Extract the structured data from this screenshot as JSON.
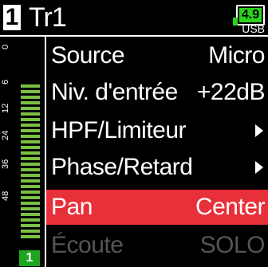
{
  "header": {
    "track_number": "1",
    "track_name": "Tr1",
    "battery": "4.9",
    "power_source": "USB",
    "battery_color": "#2bd31e"
  },
  "meter": {
    "scale": [
      "0",
      "6",
      "12",
      "24",
      "36",
      "48"
    ],
    "channel": "1",
    "bar_color": "#7bc043"
  },
  "menu": {
    "items": [
      {
        "label": "Source",
        "value": "Micro"
      },
      {
        "label": "Niv. d'entrée",
        "value": "+22dB"
      },
      {
        "label": "HPF/Limiteur",
        "icon": "chevron-right-icon"
      },
      {
        "label": "Phase/Retard",
        "icon": "chevron-right-icon"
      },
      {
        "label": "Pan",
        "value": "Center",
        "selected": true
      },
      {
        "label": "Écoute",
        "value": "SOLO",
        "disabled": true
      }
    ],
    "highlight_color": "#e8303a"
  }
}
